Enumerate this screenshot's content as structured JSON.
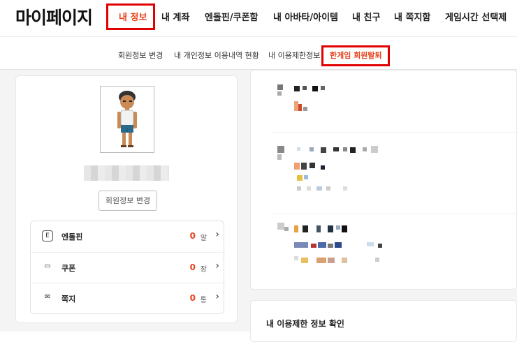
{
  "header": {
    "page_title": "마이페이지",
    "nav": [
      {
        "label": "내 정보",
        "active": true
      },
      {
        "label": "내 계좌",
        "active": false
      },
      {
        "label": "엔돌핀/쿠폰함",
        "active": false
      },
      {
        "label": "내 아바타/아이템",
        "active": false
      },
      {
        "label": "내 친구",
        "active": false
      },
      {
        "label": "내 쪽지함",
        "active": false
      },
      {
        "label": "게임시간 선택제",
        "active": false
      }
    ]
  },
  "subnav": [
    {
      "label": "회원정보 변경",
      "active": false
    },
    {
      "label": "내 개인정보 이용내역 현황",
      "active": false
    },
    {
      "label": "내 이용제한정보",
      "active": false
    },
    {
      "label": "한게임 회원탈퇴",
      "active": true
    }
  ],
  "profile": {
    "edit_button": "회원정보 변경"
  },
  "stats": [
    {
      "icon": "endorphin-icon",
      "glyph": "E",
      "label": "엔돌핀",
      "value": "0",
      "unit": "알"
    },
    {
      "icon": "coupon-icon",
      "glyph": "▭",
      "label": "쿠폰",
      "value": "0",
      "unit": "장"
    },
    {
      "icon": "message-icon",
      "glyph": "✉",
      "label": "쪽지",
      "value": "0",
      "unit": "통"
    }
  ],
  "restriction_section": {
    "title": "내 이용제한 정보 확인"
  },
  "colors": {
    "accent": "#e8421c",
    "highlight_box": "#e00000"
  }
}
